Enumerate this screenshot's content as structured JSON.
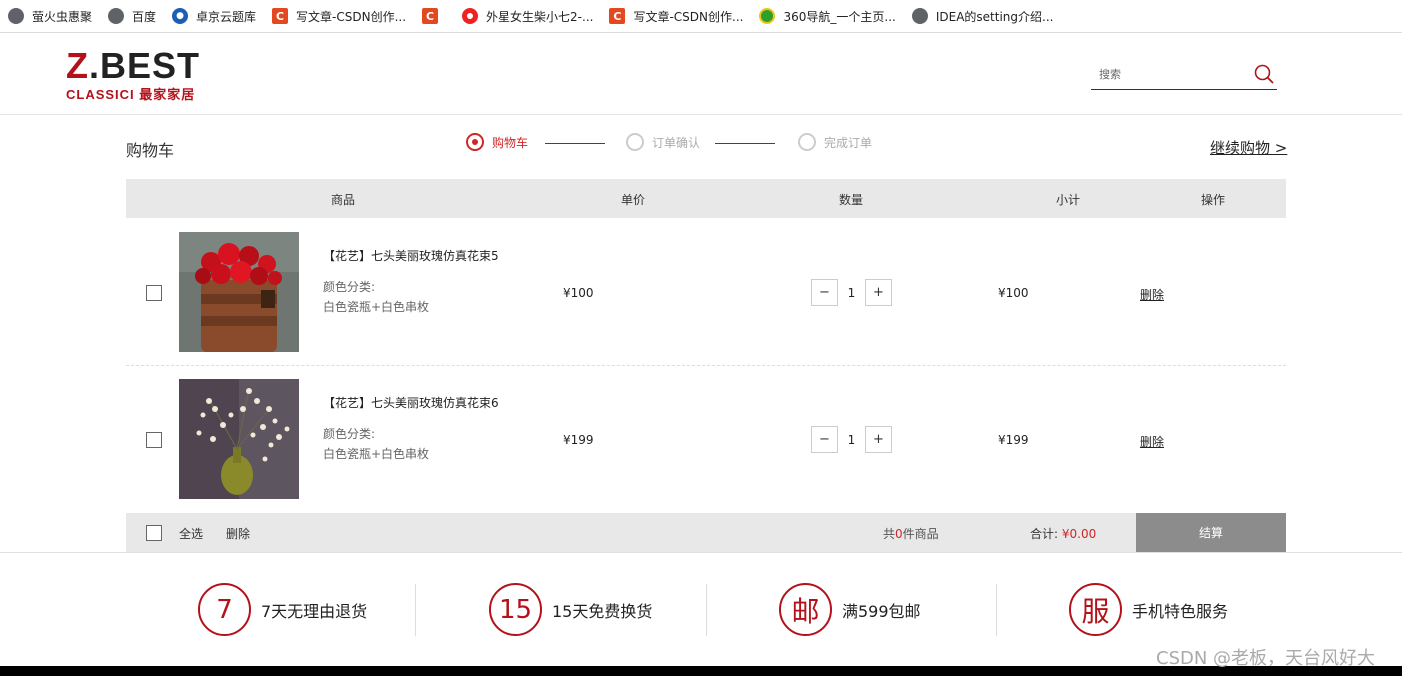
{
  "bookmarks": [
    {
      "label": "萤火虫惠聚",
      "icon": "globe-icon"
    },
    {
      "label": "百度",
      "icon": "globe-icon"
    },
    {
      "label": "卓京云题库",
      "icon": "zhuojing-icon"
    },
    {
      "label": "写文章-CSDN创作...",
      "icon": "csdn-icon"
    },
    {
      "label": "",
      "icon": "csdn-icon"
    },
    {
      "label": "外星女生柴小七2-...",
      "icon": "music-icon"
    },
    {
      "label": "写文章-CSDN创作...",
      "icon": "csdn-icon"
    },
    {
      "label": "360导航_一个主页...",
      "icon": "360-icon"
    },
    {
      "label": "IDEA的setting介绍...",
      "icon": "globe-icon"
    }
  ],
  "header": {
    "logo_main_z": "Z",
    "logo_main_rest": ".BEST",
    "logo_sub": "CLASSICI 最家家居",
    "search_placeholder": "搜索"
  },
  "cart": {
    "title": "购物车",
    "continue_label": "继续购物 >",
    "steps": [
      {
        "label": "购物车",
        "active": true
      },
      {
        "label": "订单确认",
        "active": false
      },
      {
        "label": "完成订单",
        "active": false
      }
    ],
    "columns": [
      "商品",
      "单价",
      "数量",
      "小计",
      "操作"
    ],
    "items": [
      {
        "name": "【花艺】七头美丽玫瑰仿真花束5",
        "attr_label": "颜色分类:",
        "attr_value": "白色瓷瓶+白色串枚",
        "price": "¥100",
        "qty": "1",
        "subtotal": "¥100",
        "delete": "删除",
        "minus": "−",
        "plus": "+",
        "image": "red-roses-photo"
      },
      {
        "name": "【花艺】七头美丽玫瑰仿真花束6",
        "attr_label": "颜色分类:",
        "attr_value": "白色瓷瓶+白色串枚",
        "price": "¥199",
        "qty": "1",
        "subtotal": "¥199",
        "delete": "删除",
        "minus": "−",
        "plus": "+",
        "image": "white-flowers-photo"
      }
    ],
    "footer": {
      "select_all": "全选",
      "delete": "删除",
      "count_prefix": "共",
      "count_value": "0",
      "count_suffix": "件商品",
      "total_label": "合计:",
      "total_value": "¥0.00",
      "checkout": "结算"
    }
  },
  "services": [
    {
      "badge": "7",
      "text": "7天无理由退货"
    },
    {
      "badge": "15",
      "text": "15天免费换货"
    },
    {
      "badge": "邮",
      "text": "满599包邮"
    },
    {
      "badge": "服",
      "text": "手机特色服务"
    }
  ],
  "watermark": "CSDN @老板，天台风好大",
  "colors": {
    "brand": "#b3121a",
    "accent": "#d02626",
    "checkout_bg": "#8c8c8c"
  }
}
